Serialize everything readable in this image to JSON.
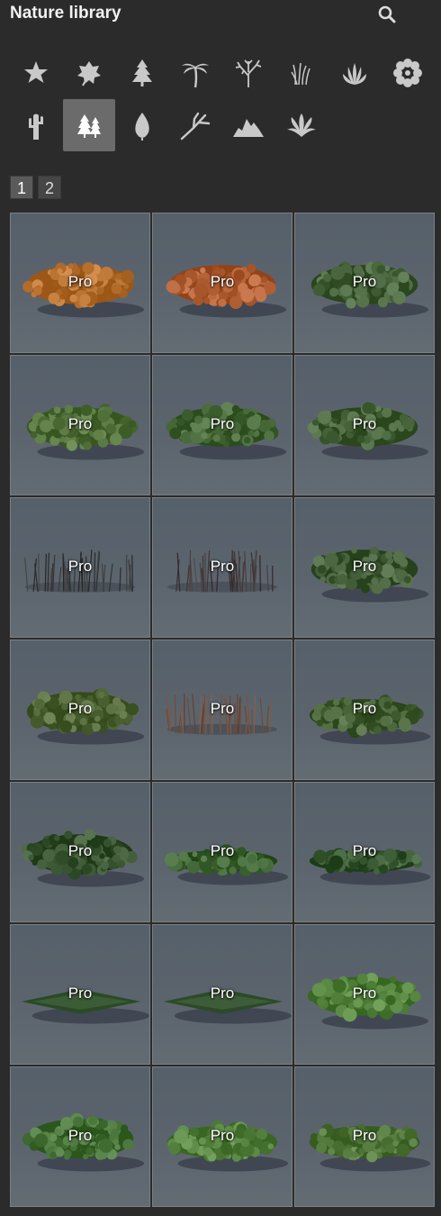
{
  "header": {
    "title": "Nature library"
  },
  "categories": [
    {
      "name": "favorites-icon",
      "active": false
    },
    {
      "name": "leaf-icon",
      "active": false
    },
    {
      "name": "conifer-icon",
      "active": false
    },
    {
      "name": "palm-icon",
      "active": false
    },
    {
      "name": "bare-tree-icon",
      "active": false
    },
    {
      "name": "grass-icon",
      "active": false
    },
    {
      "name": "plant-icon",
      "active": false
    },
    {
      "name": "flower-icon",
      "active": false
    },
    {
      "name": "cactus-icon",
      "active": false
    },
    {
      "name": "forest-icon",
      "active": true
    },
    {
      "name": "foliage-leaf-icon",
      "active": false
    },
    {
      "name": "branch-icon",
      "active": false
    },
    {
      "name": "rocks-icon",
      "active": false
    },
    {
      "name": "fern-icon",
      "active": false
    }
  ],
  "pagination": {
    "pages": [
      "1",
      "2"
    ],
    "current": "1"
  },
  "items": [
    {
      "badge": "Pro",
      "kind": "bush",
      "color": "#b06a2a"
    },
    {
      "badge": "Pro",
      "kind": "bush",
      "color": "#a8562c"
    },
    {
      "badge": "Pro",
      "kind": "bush",
      "color": "#3d5a32"
    },
    {
      "badge": "Pro",
      "kind": "bush",
      "color": "#4c6a34"
    },
    {
      "badge": "Pro",
      "kind": "bush",
      "color": "#3f6030"
    },
    {
      "badge": "Pro",
      "kind": "sparse",
      "color": "#3e5a30"
    },
    {
      "badge": "Pro",
      "kind": "reeds",
      "color": "#2e2e2e"
    },
    {
      "badge": "Pro",
      "kind": "reeds",
      "color": "#3a3030"
    },
    {
      "badge": "Pro",
      "kind": "bush",
      "color": "#3a5530"
    },
    {
      "badge": "Pro",
      "kind": "bush",
      "color": "#4a5f30"
    },
    {
      "badge": "Pro",
      "kind": "reeds",
      "color": "#6a4430"
    },
    {
      "badge": "Pro",
      "kind": "low",
      "color": "#3f5a2e"
    },
    {
      "badge": "Pro",
      "kind": "bush",
      "color": "#324d2a"
    },
    {
      "badge": "Pro",
      "kind": "flat",
      "color": "#355a2a"
    },
    {
      "badge": "Pro",
      "kind": "flat",
      "color": "#30502a"
    },
    {
      "badge": "Pro",
      "kind": "patch",
      "color": "#2a4a26"
    },
    {
      "badge": "Pro",
      "kind": "patch",
      "color": "#2c4a28"
    },
    {
      "badge": "Pro",
      "kind": "bush",
      "color": "#4a7a34"
    },
    {
      "badge": "Pro",
      "kind": "bush",
      "color": "#3f6a30"
    },
    {
      "badge": "Pro",
      "kind": "low",
      "color": "#4d7a36"
    },
    {
      "badge": "Pro",
      "kind": "low",
      "color": "#4a7034"
    }
  ]
}
